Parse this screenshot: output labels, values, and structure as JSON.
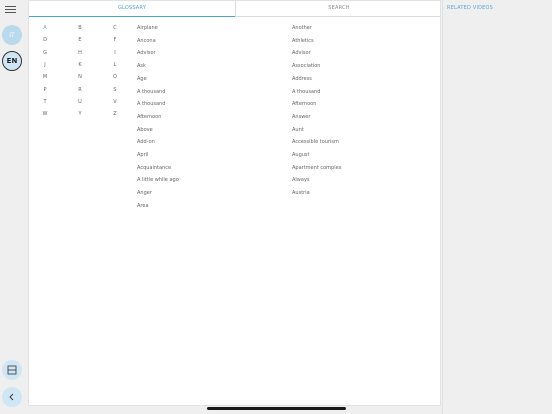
{
  "sidebar": {
    "lang_it": "IT",
    "lang_en": "EN"
  },
  "tabs": [
    {
      "label": "GLOSSARY"
    },
    {
      "label": "SEARCH"
    }
  ],
  "letters": [
    "A",
    "B",
    "C",
    "D",
    "E",
    "F",
    "G",
    "H",
    "I",
    "J",
    "K",
    "L",
    "M",
    "N",
    "O",
    "P",
    "R",
    "S",
    "T",
    "U",
    "V",
    "W",
    "Y",
    "Z"
  ],
  "active_letter": "A",
  "words_col1": [
    "Airplane",
    "Ancona",
    "Advisor",
    "Ask",
    "Age",
    "A thousand",
    "A thousand",
    "Afternoon",
    "Above",
    "Add-on",
    "April",
    "Acquaintance",
    "A little while ago",
    "Anger",
    "Area"
  ],
  "words_col2": [
    "Another",
    "Athletics",
    "Advisor",
    "Association",
    "Address",
    "A thousand",
    "Afternoon",
    "Answer",
    "Aunt",
    "Accessible tourism",
    "August",
    "Apartment complex",
    "Always",
    "Austria"
  ],
  "related_videos": {
    "title": "RELATED VIDEOS"
  },
  "colors": {
    "accent": "#4aa3d4",
    "circle_bg": "#cfe6f4"
  }
}
